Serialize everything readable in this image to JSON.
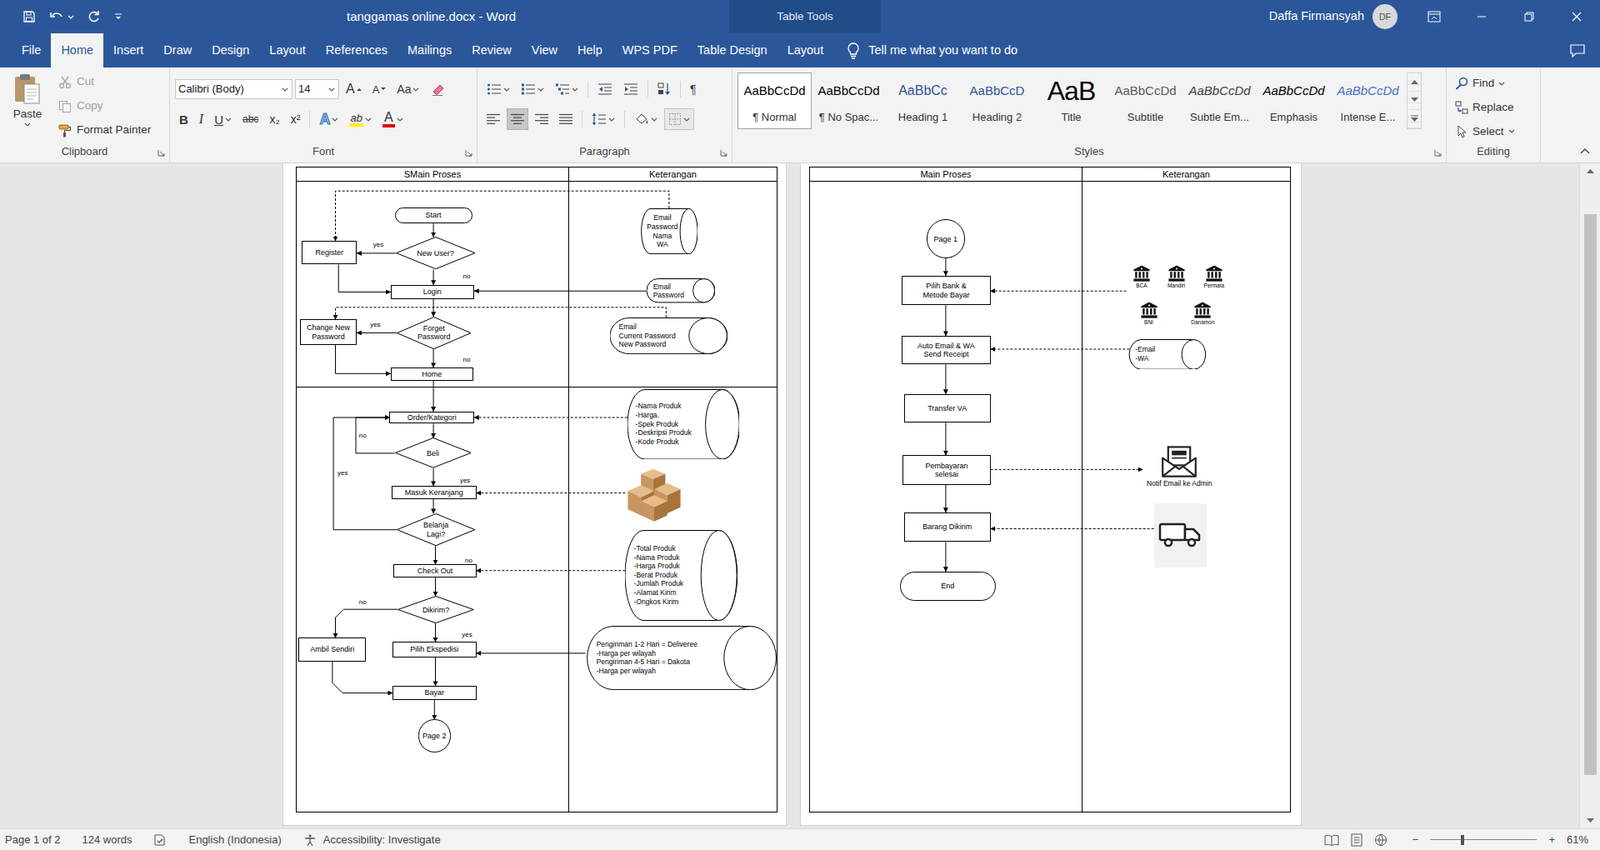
{
  "window": {
    "title": "tanggamas online.docx - Word",
    "context_title": "Table Tools",
    "user": "Daffa Firmansyah",
    "avatar": "DF"
  },
  "tabs": [
    {
      "label": "File",
      "selected": false
    },
    {
      "label": "Home",
      "selected": true
    },
    {
      "label": "Insert",
      "selected": false
    },
    {
      "label": "Draw",
      "selected": false
    },
    {
      "label": "Design",
      "selected": false
    },
    {
      "label": "Layout",
      "selected": false
    },
    {
      "label": "References",
      "selected": false
    },
    {
      "label": "Mailings",
      "selected": false
    },
    {
      "label": "Review",
      "selected": false
    },
    {
      "label": "View",
      "selected": false
    },
    {
      "label": "Help",
      "selected": false
    },
    {
      "label": "WPS PDF",
      "selected": false
    },
    {
      "label": "Table Design",
      "selected": false
    },
    {
      "label": "Layout",
      "selected": false
    }
  ],
  "tell_me": "Tell me what you want to do",
  "clipboard": {
    "label": "Clipboard",
    "paste": "Paste",
    "items": [
      {
        "label": "Cut",
        "kind": "cut",
        "disabled": true
      },
      {
        "label": "Copy",
        "kind": "copy",
        "disabled": true
      },
      {
        "label": "Format Painter",
        "kind": "painter",
        "disabled": false
      }
    ]
  },
  "font": {
    "label": "Font",
    "family": "Calibri (Body)",
    "size": "14",
    "grow": "A",
    "shrink": "A",
    "change_case": "Aa",
    "format": [
      {
        "glyph": "B",
        "kind": "bold"
      },
      {
        "glyph": "I",
        "kind": "italic"
      },
      {
        "glyph": "U",
        "kind": "underline"
      },
      {
        "glyph": "abc",
        "kind": "strike"
      },
      {
        "glyph": "x₂",
        "kind": "sub"
      },
      {
        "glyph": "x²",
        "kind": "sup"
      }
    ],
    "effects": "A",
    "highlight": "ab",
    "color": "A"
  },
  "paragraph": {
    "label": "Paragraph",
    "show_marks": "¶",
    "alignment": [
      {
        "kind": "left",
        "selected": false
      },
      {
        "kind": "center",
        "selected": true
      },
      {
        "kind": "right",
        "selected": false
      },
      {
        "kind": "justify",
        "selected": false
      }
    ]
  },
  "styles": {
    "label": "Styles",
    "items": [
      {
        "preview": "AaBbCcDd",
        "name": "¶ Normal",
        "kind": "normal",
        "selected": true
      },
      {
        "preview": "AaBbCcDd",
        "name": "¶ No Spac...",
        "kind": "normal",
        "selected": false
      },
      {
        "preview": "AaBbCc",
        "name": "Heading 1",
        "kind": "heading1",
        "selected": false
      },
      {
        "preview": "AaBbCcD",
        "name": "Heading 2",
        "kind": "heading2",
        "selected": false
      },
      {
        "preview": "AaB",
        "name": "Title",
        "kind": "title",
        "selected": false
      },
      {
        "preview": "AaBbCcDd",
        "name": "Subtitle",
        "kind": "subtitle",
        "selected": false
      },
      {
        "preview": "AaBbCcDd",
        "name": "Subtle Em...",
        "kind": "subtle",
        "selected": false
      },
      {
        "preview": "AaBbCcDd",
        "name": "Emphasis",
        "kind": "emphasis",
        "selected": false
      },
      {
        "preview": "AaBbCcDd",
        "name": "Intense E...",
        "kind": "intense",
        "selected": false
      }
    ]
  },
  "editing": {
    "label": "Editing",
    "items": [
      {
        "label": "Find",
        "kind": "find"
      },
      {
        "label": "Replace",
        "kind": "replace"
      },
      {
        "label": "Select",
        "kind": "select"
      }
    ]
  },
  "document": {
    "pages": [
      {
        "columns": [
          "SMain Proses",
          "Keterangan"
        ],
        "nodes": [
          {
            "kind": "terminator",
            "text": "Start"
          },
          {
            "kind": "decision",
            "text": "New User?"
          },
          {
            "kind": "process",
            "text": "Register"
          },
          {
            "kind": "label",
            "text": "yes"
          },
          {
            "kind": "label",
            "text": "no"
          },
          {
            "kind": "process",
            "text": "Login"
          },
          {
            "kind": "decision",
            "text": "Forget\nPassword"
          },
          {
            "kind": "process",
            "text": "Change New\nPassword"
          },
          {
            "kind": "label",
            "text": "yes"
          },
          {
            "kind": "label",
            "text": "no"
          },
          {
            "kind": "process",
            "text": "Home"
          },
          {
            "kind": "process",
            "text": "Order/Kategori"
          },
          {
            "kind": "decision",
            "text": "Beli"
          },
          {
            "kind": "label",
            "text": "no"
          },
          {
            "kind": "label",
            "text": "yes"
          },
          {
            "kind": "label",
            "text": "yes"
          },
          {
            "kind": "process",
            "text": "Masuk Keranjang"
          },
          {
            "kind": "decision",
            "text": "Belanja\nLagi?"
          },
          {
            "kind": "label",
            "text": "no"
          },
          {
            "kind": "process",
            "text": "Check Out"
          },
          {
            "kind": "decision",
            "text": "Dikirim?"
          },
          {
            "kind": "label",
            "text": "no"
          },
          {
            "kind": "label",
            "text": "yes"
          },
          {
            "kind": "process",
            "text": "Ambil Sendiri"
          },
          {
            "kind": "process",
            "text": "Pilih Ekspedisi"
          },
          {
            "kind": "process",
            "text": "Bayar"
          },
          {
            "kind": "connector",
            "text": "Page 2"
          },
          {
            "kind": "store",
            "lines": [
              "Email",
              "Password",
              "Nama",
              "WA"
            ]
          },
          {
            "kind": "store",
            "lines": [
              "Email",
              "Password"
            ]
          },
          {
            "kind": "store",
            "lines": [
              "Email",
              "Current Password",
              "New Password"
            ]
          },
          {
            "kind": "store",
            "lines": [
              "-Nama Produk",
              "-Harga.",
              "-Spek Produk",
              "-Deskripsi Produk",
              "-Kode Produk"
            ]
          },
          {
            "kind": "boxes"
          },
          {
            "kind": "store",
            "lines": [
              "-Total Produk",
              "-Nama Produk",
              "-Harga Produk",
              "-Berat Produk",
              "-Jumlah Produk",
              "-Alamat Kirim",
              "-Ongkos Kirim"
            ]
          },
          {
            "kind": "store",
            "lines": [
              "Pengiriman 1-2 Hari = Deliveree",
              "-Harga per wilayah",
              "Pengiriman 4-5 Hari = Dakota",
              "-Harga per wilayah"
            ]
          }
        ]
      },
      {
        "columns": [
          "Main Proses",
          "Keterangan"
        ],
        "nodes": [
          {
            "kind": "connector",
            "text": "Page 1"
          },
          {
            "kind": "process",
            "text": "Pilih Bank &\nMetode Bayar"
          },
          {
            "kind": "process",
            "text": "Auto Email & WA\nSend Receipt"
          },
          {
            "kind": "process",
            "text": "Transfer VA"
          },
          {
            "kind": "process",
            "text": "Pembayaran\nselesai"
          },
          {
            "kind": "process",
            "text": "Barang Dikirim"
          },
          {
            "kind": "terminator",
            "text": "End"
          },
          {
            "kind": "bank",
            "text": "BCA"
          },
          {
            "kind": "bank",
            "text": "Mandiri"
          },
          {
            "kind": "bank",
            "text": "Permata"
          },
          {
            "kind": "bank",
            "text": "BNI"
          },
          {
            "kind": "bank",
            "text": "Danamon"
          },
          {
            "kind": "store",
            "lines": [
              "-Email",
              "-WA"
            ]
          },
          {
            "kind": "mail",
            "text": "Notif Email ke Admin"
          },
          {
            "kind": "truck"
          }
        ]
      }
    ]
  },
  "status_bar": {
    "page": "Page 1 of 2",
    "words": "124 words",
    "language": "English (Indonesia)",
    "accessibility": "Accessibility: Investigate",
    "zoom_out": "−",
    "zoom_in": "+",
    "zoom": "61%",
    "zoom_level": 0.29
  },
  "scrollbar": {
    "offset": 0.056,
    "size": 0.883
  }
}
